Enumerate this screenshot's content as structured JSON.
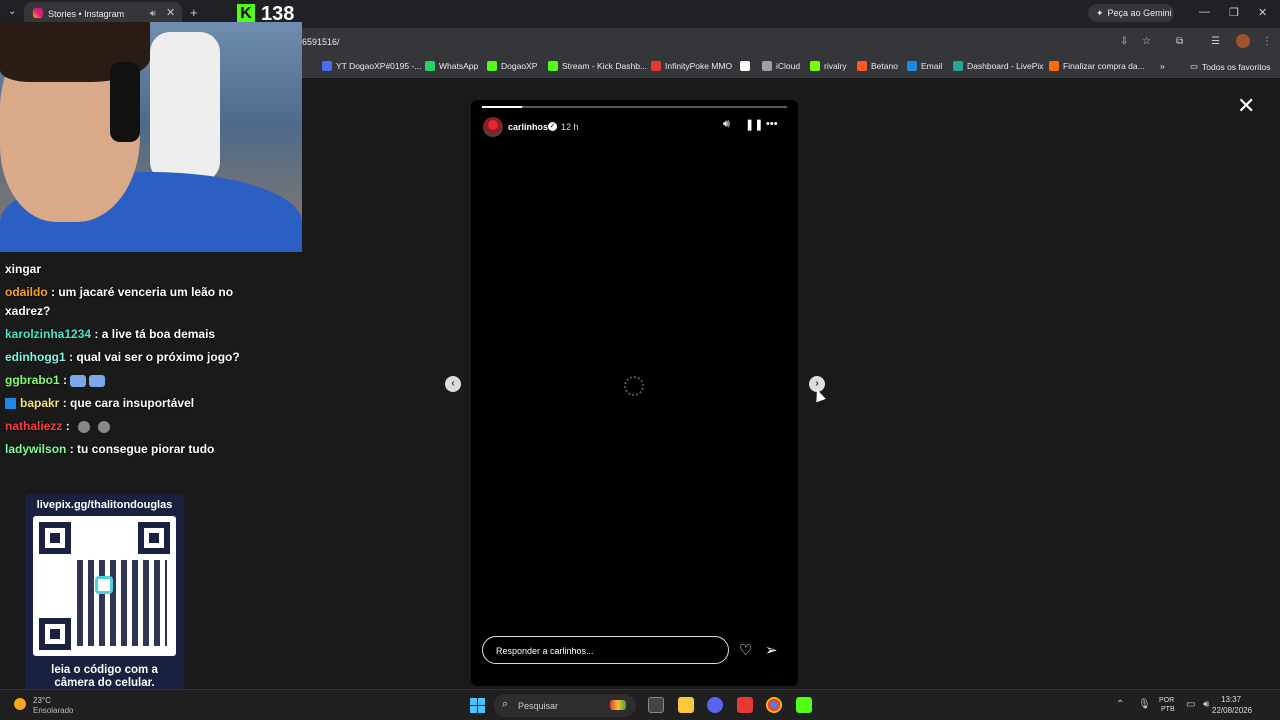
{
  "browser": {
    "tab_title": "Stories • Instagram",
    "url_fragment": "6591516/",
    "gemini_label": "Peça ao Gemini",
    "bookmarks": [
      {
        "label": "YT DogaoXP#0195 -...",
        "icon": "youtube-icon",
        "color": "#4a6cf7"
      },
      {
        "label": "WhatsApp",
        "icon": "whatsapp-icon",
        "color": "#25d366"
      },
      {
        "label": "DogaoXP",
        "icon": "kick-icon",
        "color": "#53fc18"
      },
      {
        "label": "Stream - Kick Dashb...",
        "icon": "kick-icon",
        "color": "#53fc18"
      },
      {
        "label": "InfinityPoke MMO",
        "icon": "pokeball-icon",
        "color": "#e53935"
      },
      {
        "label": "",
        "icon": "x-icon",
        "color": "#ffffff"
      },
      {
        "label": "iCloud",
        "icon": "icloud-icon",
        "color": "#9e9e9e"
      },
      {
        "label": "rivalry",
        "icon": "rivalry-icon",
        "color": "#76ff03"
      },
      {
        "label": "Betano",
        "icon": "betano-icon",
        "color": "#ff5722"
      },
      {
        "label": "Email",
        "icon": "email-icon",
        "color": "#1e88e5"
      },
      {
        "label": "Dashboard - LivePix",
        "icon": "livepix-icon",
        "color": "#26a69a"
      },
      {
        "label": "Finalizar compra da...",
        "icon": "shop-icon",
        "color": "#ff6d00"
      }
    ],
    "favorites_label": "Todos os favoritos"
  },
  "overlay": {
    "kick_viewers": "138"
  },
  "story": {
    "username": "carlinhos",
    "time": "12 h",
    "reply_placeholder": "Responder a carlinhos...",
    "progress": 0.13
  },
  "chat": [
    {
      "user": "",
      "user_color": "#ffffff",
      "message": "xingar"
    },
    {
      "user": "odaildo",
      "user_color": "#ff9f1c",
      "message": ": um jacaré venceria um leão no"
    },
    {
      "user": "",
      "user_color": "#ffffff",
      "message": "xadrez?"
    },
    {
      "user": "karolzinha1234",
      "user_color": "#3ee8c8",
      "message": ": a live tá boa demais"
    },
    {
      "user": "edinhogg1",
      "user_color": "#7ff5e0",
      "message": ": qual vai ser o próximo jogo?"
    },
    {
      "user": "ggbrabo1",
      "user_color": "#7fff6a",
      "message": ":"
    },
    {
      "user": "bapakr",
      "user_color": "#f5e27a",
      "message": ": que cara insuportável"
    },
    {
      "user": "nathaliezz",
      "user_color": "#ff3b3b",
      "message": ":"
    },
    {
      "user": "ladywilson",
      "user_color": "#7fff9a",
      "message": ": tu consegue piorar tudo"
    }
  ],
  "qr": {
    "title": "livepix.gg/thalitondouglas",
    "caption_line1": "leia o código com a",
    "caption_line2": "câmera do celular."
  },
  "taskbar": {
    "weather_temp": "23°C",
    "weather_desc": "Ensolarado",
    "search_placeholder": "Pesquisar",
    "lang_line1": "POR",
    "lang_line2": "PTB",
    "time": "13:37",
    "date": "22/08/2026"
  }
}
